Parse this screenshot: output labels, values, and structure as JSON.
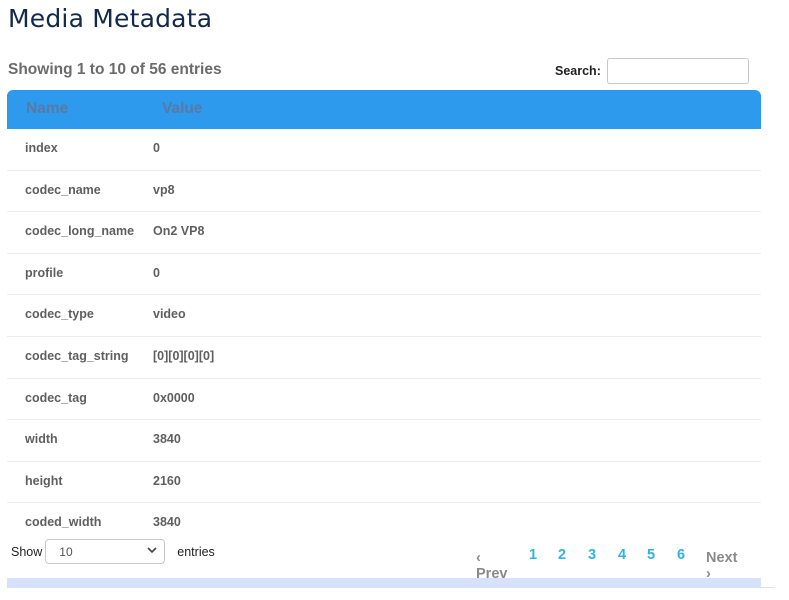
{
  "page": {
    "title": "Media Metadata"
  },
  "summary": "Showing 1 to 10 of 56 entries",
  "search": {
    "label": "Search:",
    "value": "",
    "placeholder": ""
  },
  "table": {
    "columns": [
      "Name",
      "Value"
    ],
    "rows": [
      {
        "name": "index",
        "value": "0"
      },
      {
        "name": "codec_name",
        "value": "vp8"
      },
      {
        "name": "codec_long_name",
        "value": "On2 VP8"
      },
      {
        "name": "profile",
        "value": "0"
      },
      {
        "name": "codec_type",
        "value": "video"
      },
      {
        "name": "codec_tag_string",
        "value": "[0][0][0][0]"
      },
      {
        "name": "codec_tag",
        "value": "0x0000"
      },
      {
        "name": "width",
        "value": "3840"
      },
      {
        "name": "height",
        "value": "2160"
      },
      {
        "name": "coded_width",
        "value": "3840"
      }
    ]
  },
  "footer": {
    "show_label": "Show",
    "entries_value": "10",
    "entries_label": "entries"
  },
  "pagination": {
    "prev": "‹ Prev",
    "pages": [
      "1",
      "2",
      "3",
      "4",
      "5",
      "6"
    ],
    "next": "Next ›"
  },
  "colors": {
    "header_bg": "#2d9aee",
    "page_link": "#2fb3e6",
    "title": "#13294b"
  },
  "icons": {
    "select_chevron": "chevron-down-icon"
  }
}
